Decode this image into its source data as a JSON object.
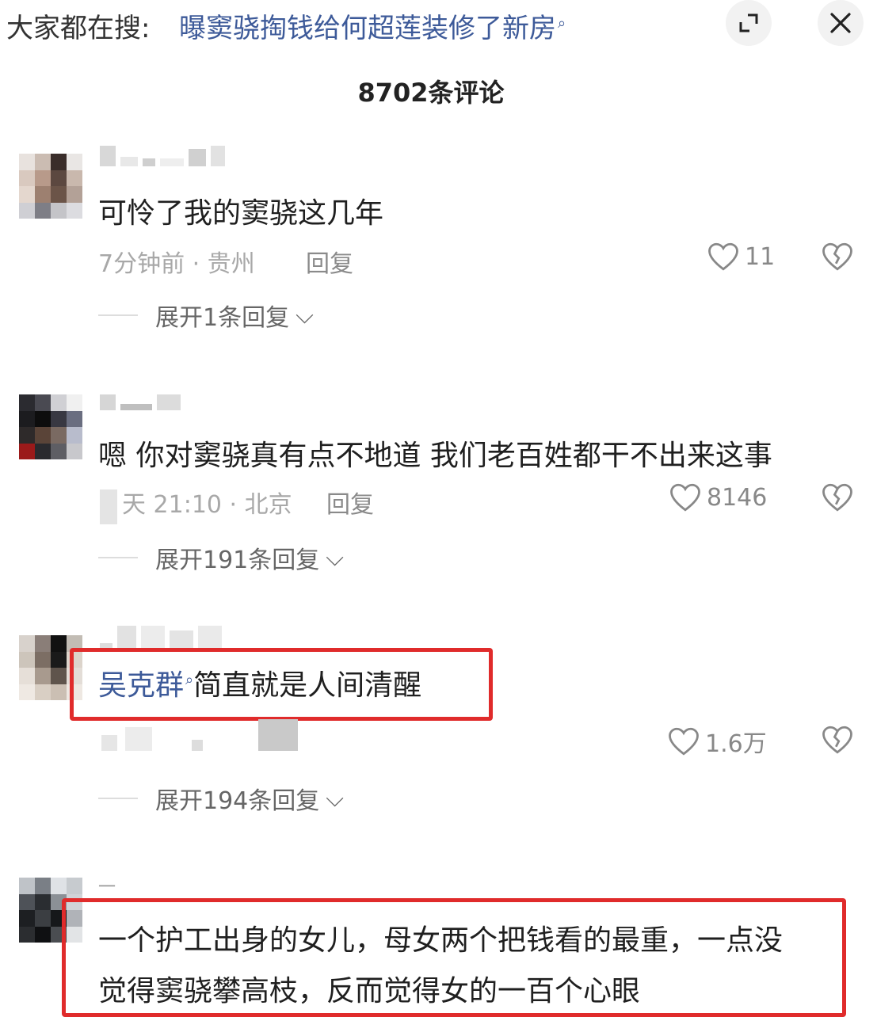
{
  "search_bar": {
    "prefix": "大家都在搜:",
    "query": "曝窦骁掏钱给何超莲装修了新房",
    "expand_icon": "expand-icon",
    "close_icon": "close-icon"
  },
  "header": {
    "comment_count": "8702条评论"
  },
  "comments": [
    {
      "text": "可怜了我的窦骁这几年",
      "meta": "7分钟前 · 贵州",
      "reply_label": "回复",
      "likes": "11",
      "expand_label": "展开1条回复"
    },
    {
      "text": "嗯 你对窦骁真有点不地道 我们老百姓都干不出来这事",
      "meta": "天 21:10 · 北京",
      "reply_label": "回复",
      "likes": "8146",
      "expand_label": "展开191条回复"
    },
    {
      "mention": "吴克群",
      "text": "简直就是人间清醒",
      "likes": "1.6万",
      "expand_label": "展开194条回复"
    },
    {
      "username": "一",
      "text_line1": "一个护工出身的女儿，母女两个把钱看的最重，一点没",
      "text_line2": "觉得窦骁攀高枝，反而觉得女的一百个心眼"
    }
  ],
  "colors": {
    "link_blue": "#3d5a99",
    "highlight_red": "#e02b2b",
    "meta_gray": "#a8a8a8"
  }
}
